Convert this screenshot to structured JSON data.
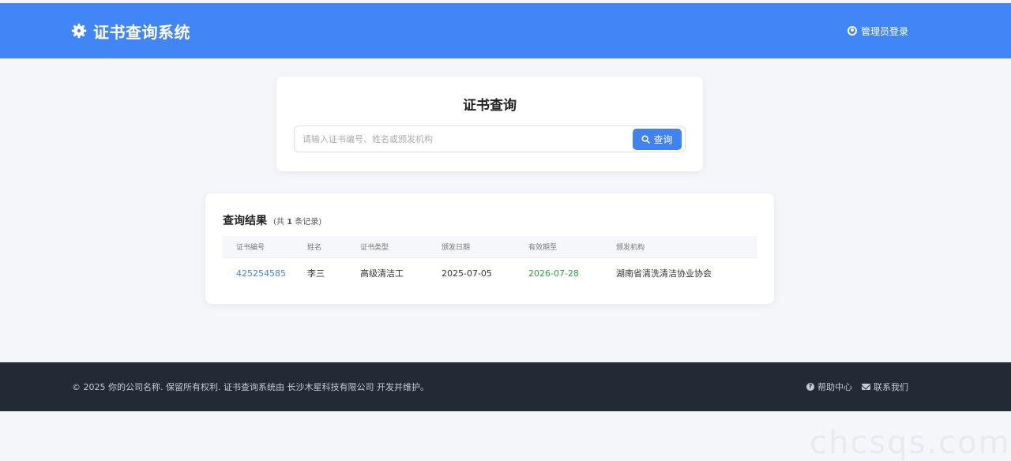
{
  "header": {
    "title": "证书查询系统",
    "brand_icon": "gear-icon",
    "admin_login": "管理员登录",
    "accent": "#4285f4"
  },
  "search": {
    "title": "证书查询",
    "placeholder": "请输入证书编号、姓名或颁发机构",
    "value": "",
    "button_label": "查询"
  },
  "results": {
    "title": "查询结果",
    "count_prefix": "(共",
    "count": "1",
    "count_suffix": "条记录)",
    "columns": [
      "证书编号",
      "姓名",
      "证书类型",
      "颁发日期",
      "有效期至",
      "颁发机构"
    ],
    "rows": [
      {
        "cert_no": "425254585",
        "name": "李三",
        "type": "高级清洁工",
        "issue_date": "2025-07-05",
        "valid_until": "2026-07-28",
        "issuer": "湖南省清洗清洁协业协会"
      }
    ]
  },
  "footer": {
    "copyright": "© 2025 你的公司名称. 保留所有权利. 证书查询系统由 长沙木星科技有限公司 开发并维护。",
    "help": "帮助中心",
    "contact": "联系我们"
  },
  "watermark": "chcsqs.com"
}
